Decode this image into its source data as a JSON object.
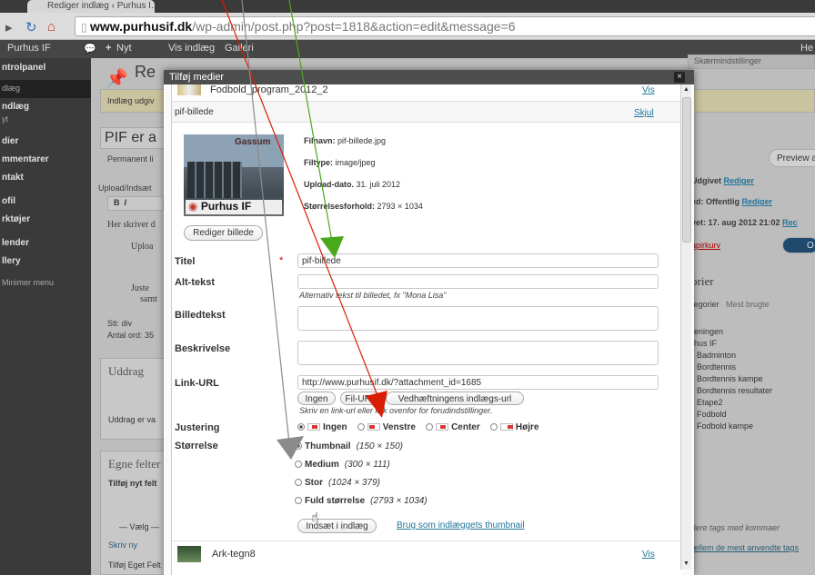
{
  "browser": {
    "tab_title": "Rediger indlæg ‹ Purhus I...",
    "url_domain": "www.purhusif.dk",
    "url_rest": "/wp-admin/post.php?post=1818&action=edit&message=6"
  },
  "adminbar": {
    "site": "Purhus IF",
    "new": "Nyt",
    "view": "Vis indlæg",
    "gallery": "Galleri",
    "right": "He"
  },
  "sidebar": {
    "items": [
      "ntrolpanel",
      "dlæg",
      "ndlæg",
      "yt",
      "dier",
      "mmentarer",
      "ntakt",
      "ofil",
      "rktøjer",
      "lender",
      "llery",
      "Minimer menu"
    ]
  },
  "main": {
    "screen_options": "Skærmindstillinger",
    "title_partial": "Re",
    "notice": "Indlæg udgiv",
    "post_title": "PIF er a",
    "permalink": "Permanent li",
    "upload": "Upload/Indsæt",
    "content1": "Her skriver d",
    "bullet1": "Uploa",
    "bullet2": "Juste",
    "bullet2b": "samt",
    "path": "Sti: div",
    "wordcount": "Antal ord: 35",
    "excerpt_title": "Uddrag",
    "excerpt_note": "Uddrag er va",
    "custom_fields": "Egne felter",
    "add_field": "Tilføj nyt felt",
    "select": "— Vælg —",
    "write_new": "Skriv ny",
    "add_custom_field": "Tilføj Eget Felt",
    "preview": "Preview a",
    "published": "Udgivet",
    "edit": "Rediger",
    "status_label": "ed: Offentlig",
    "published_date": "vet: 17. aug 2012 21:02",
    "trash": "apirkurv",
    "update_btn": "O",
    "categories_title": "orier",
    "cat_tab_all": "tegorier",
    "cat_tab_popular": "Mest brugte",
    "categories": [
      "reningen",
      "rhus IF",
      "Badminton",
      "Bordtennis",
      "Bordtennis kampe",
      "Bordtennis resultater",
      "Etape2",
      "Fodbold",
      "Fodbold kampe"
    ],
    "tags_hint": "flere tags med kommaer",
    "tags_link": "ællem de mest anvendte tags"
  },
  "modal": {
    "title": "Tilføj medier",
    "close": "×",
    "prev_item": "Fodbold_program_2012_2",
    "prev_item_link": "Vis",
    "item_name": "pif-billede",
    "hide_link": "Skjul",
    "thumb_text_top": "Gassum",
    "thumb_text_bottom": "Purhus IF",
    "meta": {
      "filename_label": "Filnavn:",
      "filename": "pif-billede.jpg",
      "filetype_label": "Filtype:",
      "filetype": "image/jpeg",
      "date_label": "Upload-dato.",
      "date": "31. juli 2012",
      "dims_label": "Størrelsesforhold:",
      "dims": "2793 × 1034"
    },
    "edit_image_btn": "Rediger billede",
    "fields": {
      "title_label": "Titel",
      "required": "*",
      "title_value": "pif-billede",
      "alt_label": "Alt-tekst",
      "alt_value": "",
      "alt_hint": "Alternativ tekst til billedet, fx \"Mona Lisa\"",
      "caption_label": "Billedtekst",
      "caption_value": "",
      "desc_label": "Beskrivelse",
      "desc_value": "",
      "link_label": "Link-URL",
      "link_value": "http://www.purhusif.dk/?attachment_id=1685",
      "link_btn_none": "Ingen",
      "link_btn_file": "Fil-URL",
      "link_btn_post": "Vedhæftningens indlægs-url",
      "link_hint": "Skriv en link-url eller klik ovenfor for forudindstillinger.",
      "align_label": "Justering",
      "align_options": [
        "Ingen",
        "Venstre",
        "Center",
        "Højre"
      ],
      "align_selected": "Ingen",
      "size_label": "Størrelse",
      "sizes": [
        {
          "name": "Thumbnail",
          "dims": "(150 × 150)",
          "selected": true
        },
        {
          "name": "Medium",
          "dims": "(300 × 111)",
          "selected": false
        },
        {
          "name": "Stor",
          "dims": "(1024 × 379)",
          "selected": false
        },
        {
          "name": "Fuld størrelse",
          "dims": "(2793 × 1034)",
          "selected": false
        }
      ]
    },
    "insert_btn": "Indsæt i indlæg",
    "thumbnail_link": "Brug som indlæggets thumbnail",
    "next_item": "Ark-tegn8",
    "next_item_link": "Vis"
  },
  "colors": {
    "arrow_red": "#d81e05",
    "arrow_green": "#4aa81c",
    "arrow_gray": "#8a8a8a"
  }
}
